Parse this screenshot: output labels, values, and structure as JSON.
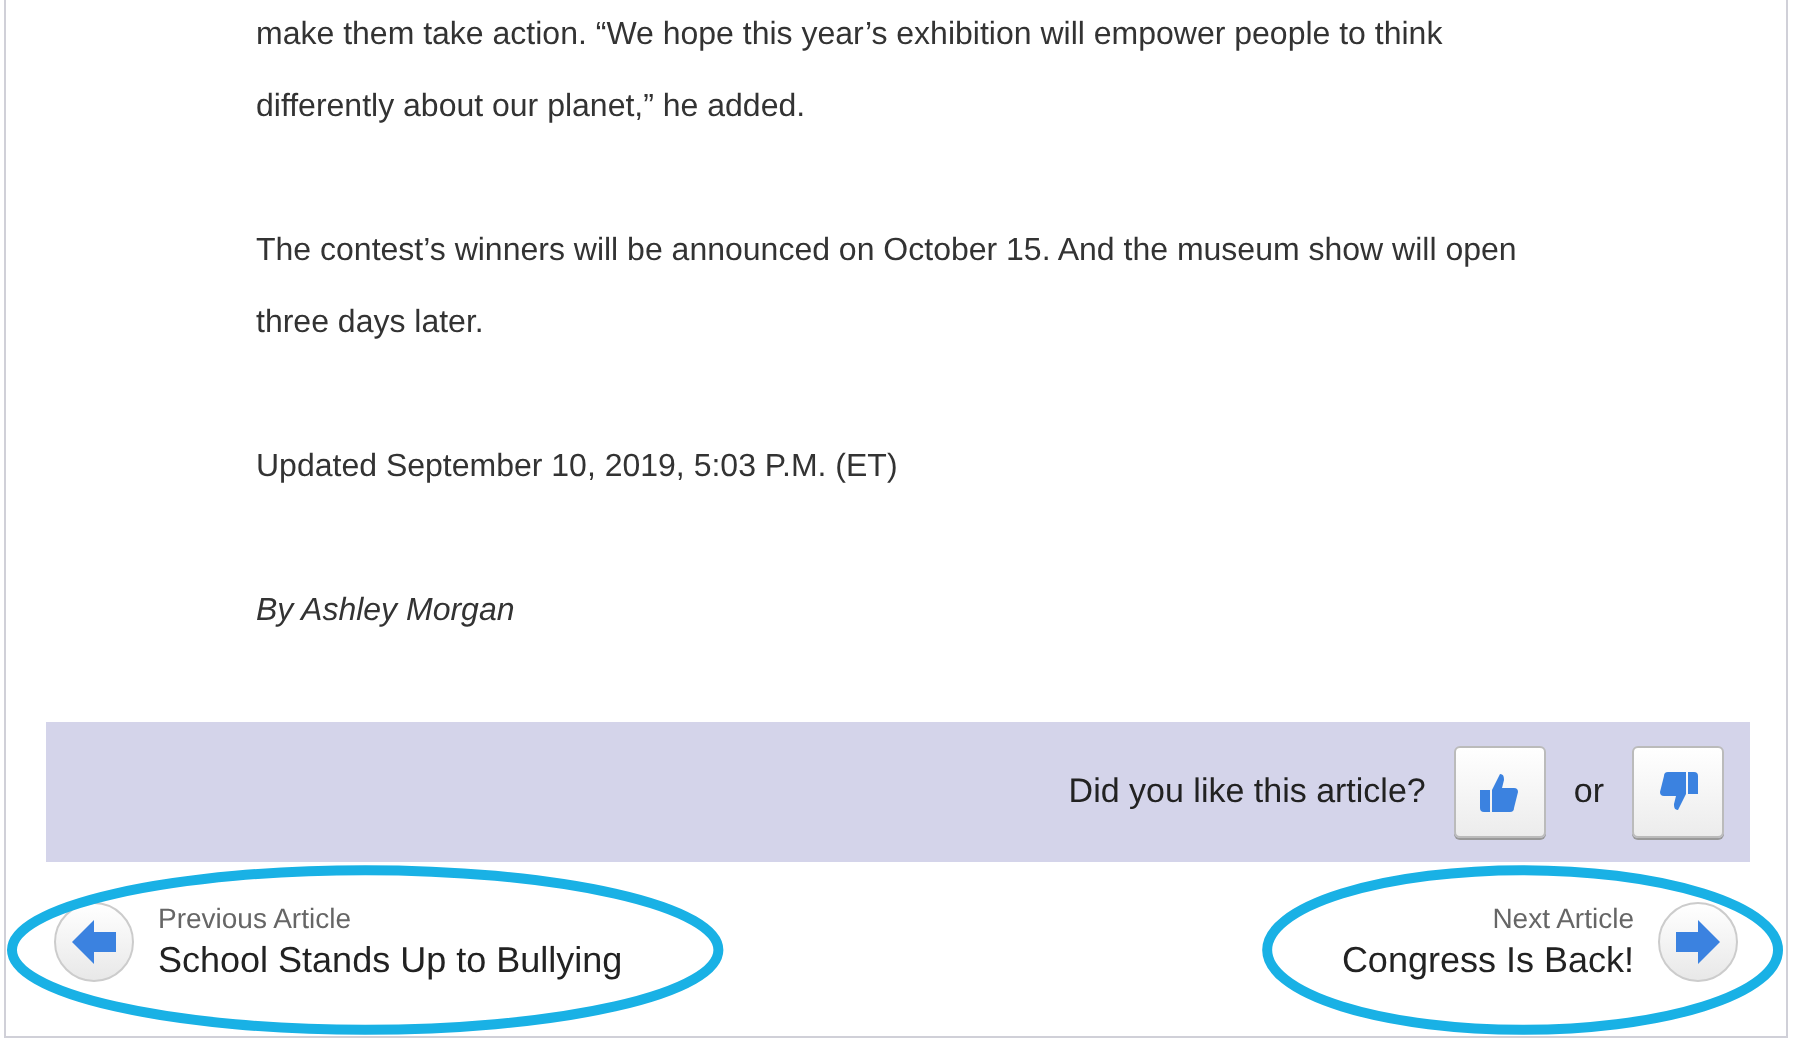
{
  "article": {
    "paragraphs": [
      "make them take action. “We hope this year’s exhibition will empower people to think differently about our planet,” he added.",
      "The contest’s winners will be announced on October 15. And the museum show will open three days later.",
      "Updated September 10, 2019, 5:03 P.M. (ET)"
    ],
    "byline": "By Ashley Morgan"
  },
  "feedback": {
    "question": "Did you like this article?",
    "separator": "or"
  },
  "navigation": {
    "previous": {
      "label": "Previous Article",
      "title": "School Stands Up to Bullying",
      "highlighted": true
    },
    "next": {
      "label": "Next Article",
      "title": "Congress Is Back!",
      "highlighted": true
    }
  }
}
